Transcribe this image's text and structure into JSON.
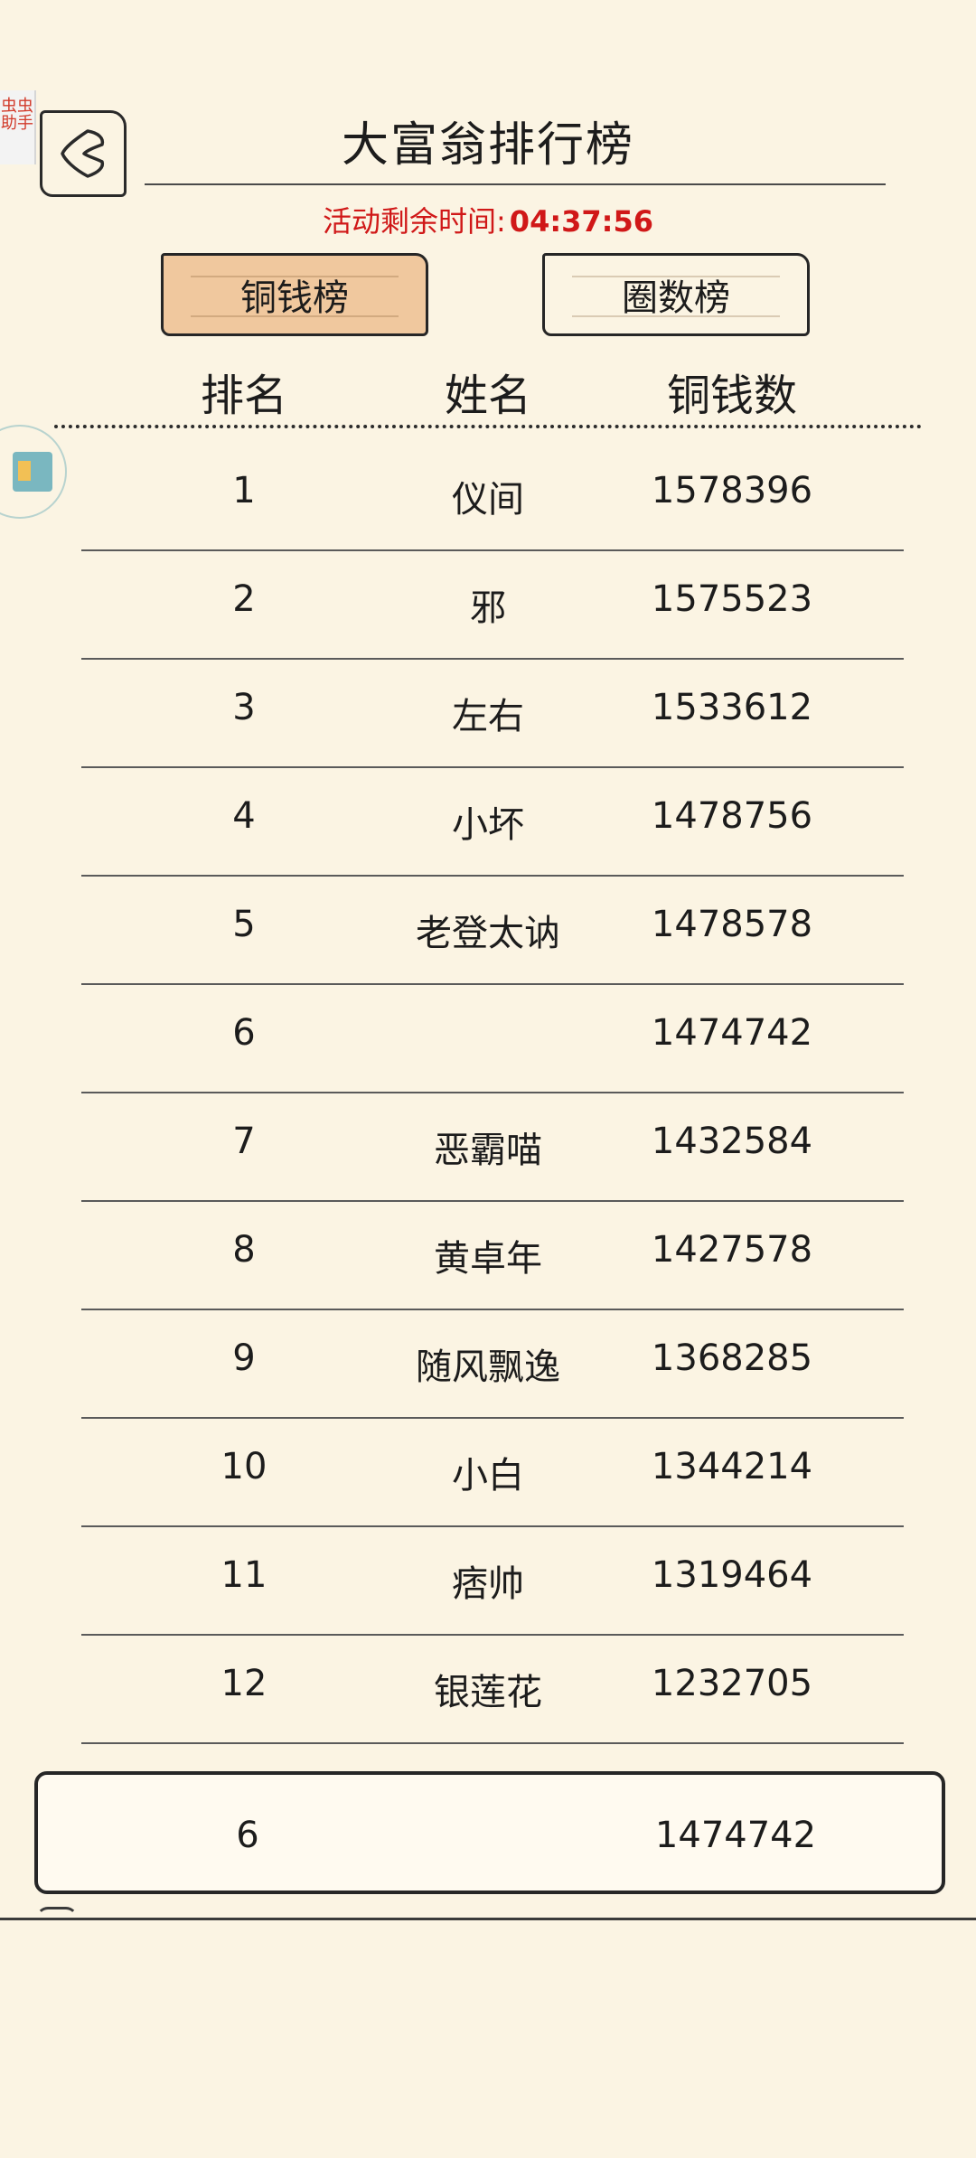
{
  "helper": {
    "label": "虫虫助手"
  },
  "header": {
    "title": "大富翁排行榜",
    "countdown_label": "活动剩余时间:",
    "countdown_value": "04:37:56"
  },
  "tabs": [
    {
      "label": "铜钱榜",
      "active": true
    },
    {
      "label": "圈数榜",
      "active": false
    }
  ],
  "columns": {
    "rank": "排名",
    "name": "姓名",
    "coins": "铜钱数"
  },
  "rows": [
    {
      "rank": "1",
      "name": "仪间",
      "coins": "1578396"
    },
    {
      "rank": "2",
      "name": "邪",
      "coins": "1575523"
    },
    {
      "rank": "3",
      "name": "左右",
      "coins": "1533612"
    },
    {
      "rank": "4",
      "name": "小坏",
      "coins": "1478756"
    },
    {
      "rank": "5",
      "name": "老登太讷",
      "coins": "1478578"
    },
    {
      "rank": "6",
      "name": "",
      "coins": "1474742"
    },
    {
      "rank": "7",
      "name": "恶霸喵",
      "coins": "1432584"
    },
    {
      "rank": "8",
      "name": "黄卓年",
      "coins": "1427578"
    },
    {
      "rank": "9",
      "name": "随风飘逸",
      "coins": "1368285"
    },
    {
      "rank": "10",
      "name": "小白",
      "coins": "1344214"
    },
    {
      "rank": "11",
      "name": "痞帅",
      "coins": "1319464"
    },
    {
      "rank": "12",
      "name": "银莲花",
      "coins": "1232705"
    }
  ],
  "my_row": {
    "rank": "6",
    "name": "",
    "coins": "1474742"
  },
  "colors": {
    "background": "#fbf4e3",
    "accent_tab": "#f0c89e",
    "countdown": "#d01818"
  },
  "icons": {
    "back": "chevron-left-icon",
    "side": "floating-app-icon"
  }
}
